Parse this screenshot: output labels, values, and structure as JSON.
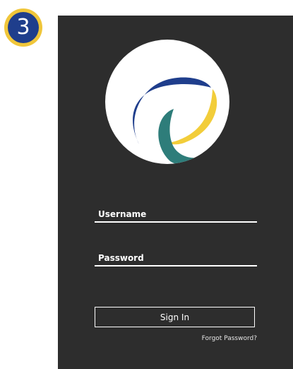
{
  "step_badge": {
    "number": "3"
  },
  "login": {
    "logo": {
      "icon": "app-logo-icon",
      "colors": {
        "blue": "#1f3e8c",
        "yellow": "#f2cd3a",
        "teal": "#2e7d7a"
      }
    },
    "username_label": "Username",
    "password_label": "Password",
    "signin_label": "Sign In",
    "forgot_label": "Forgot Password?"
  },
  "colors": {
    "background": "#2d2d2d",
    "badge_ring": "#f0c63a",
    "badge_fill": "#1f3e8c",
    "text": "#ffffff"
  }
}
